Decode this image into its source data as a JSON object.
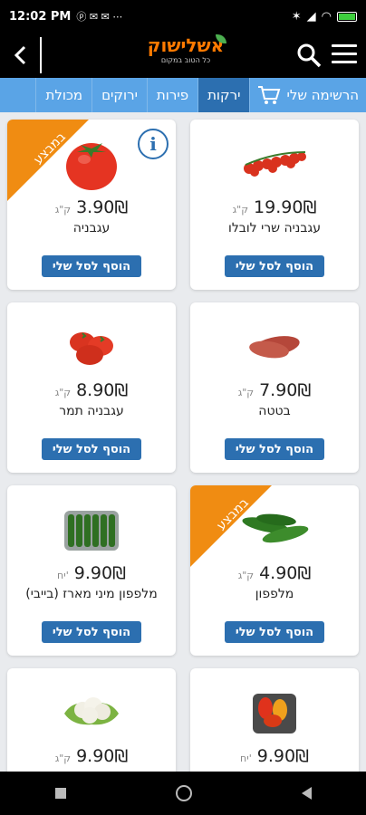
{
  "status": {
    "time": "12:02 PM",
    "icons_left": "ⓟ ✉ ✉ ⋯",
    "battery": "100"
  },
  "header": {
    "back_icon": "chevron-left-icon",
    "logo_word": "אשלישוק",
    "logo_tagline": "כל הטוב במקום",
    "search_icon": "search-icon",
    "menu_icon": "hamburger-menu-icon"
  },
  "tabs": [
    {
      "label": "הרשימה שלי",
      "icon": "cart-icon",
      "active": false
    },
    {
      "label": "ירקות",
      "active": true
    },
    {
      "label": "פירות",
      "active": false
    },
    {
      "label": "ירוקים",
      "active": false
    },
    {
      "label": "מכולת",
      "active": false
    }
  ],
  "products": [
    {
      "name": "עגבניה שרי לובלו",
      "price": "19.90",
      "currency": "₪",
      "unit": "ק\"ג",
      "on_sale": false,
      "image": "cherry-tomato-vine-image"
    },
    {
      "name": "עגבניה",
      "price": "3.90",
      "currency": "₪",
      "unit": "ק\"ג",
      "on_sale": true,
      "info": true,
      "image": "tomato-image"
    },
    {
      "name": "בטטה",
      "price": "7.90",
      "currency": "₪",
      "unit": "ק\"ג",
      "on_sale": false,
      "image": "sweet-potato-image"
    },
    {
      "name": "עגבניה תמר",
      "price": "8.90",
      "currency": "₪",
      "unit": "ק\"ג",
      "on_sale": false,
      "image": "plum-tomato-image"
    },
    {
      "name": "מלפפון",
      "price": "4.90",
      "currency": "₪",
      "unit": "ק\"ג",
      "on_sale": true,
      "image": "cucumber-image"
    },
    {
      "name": "מלפפון מיני מארז (בייבי)",
      "price": "9.90",
      "currency": "₪",
      "unit": "יח'",
      "on_sale": false,
      "image": "mini-cucumber-pack-image"
    },
    {
      "name": "",
      "price": "9.90",
      "currency": "₪",
      "unit": "יח'",
      "on_sale": false,
      "image": "mixed-peppers-image"
    },
    {
      "name": "",
      "price": "9.90",
      "currency": "₪",
      "unit": "ק\"ג",
      "on_sale": false,
      "image": "cauliflower-image"
    }
  ],
  "labels": {
    "add_to_cart": "הוסף לסל שלי",
    "sale_ribbon": "במבצע",
    "info": "i"
  },
  "colors": {
    "tab_bar": "#5aa4e6",
    "tab_active": "#2c6fb0",
    "button": "#2c6fb0",
    "ribbon": "#f08c12",
    "logo": "#ff7a00"
  }
}
